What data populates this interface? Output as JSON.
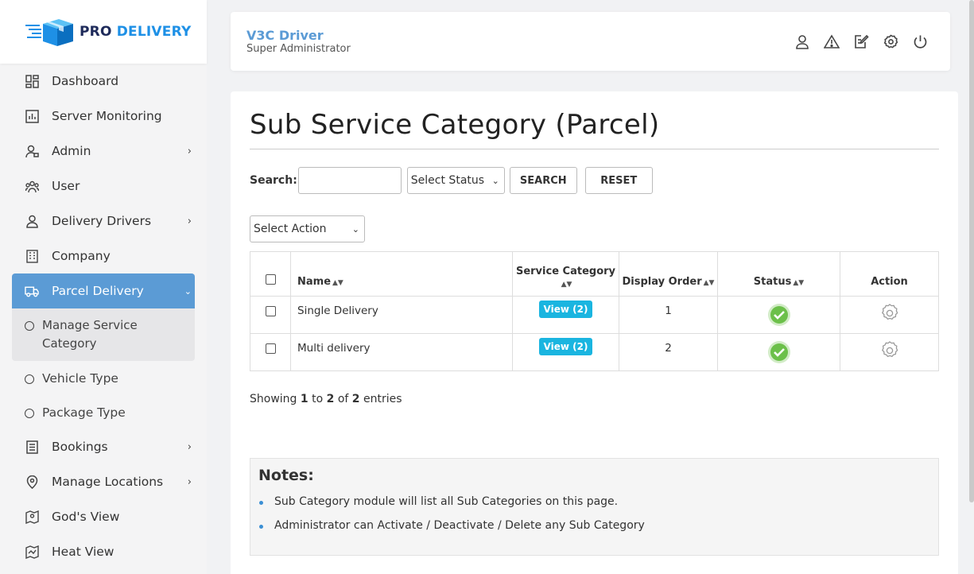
{
  "brand": {
    "pro": "PRO",
    "delivery": "DELIVERY",
    "colors": {
      "navy": "#1e2a5a",
      "blue": "#1e90e6"
    }
  },
  "sidebar": {
    "items": [
      {
        "label": "Dashboard",
        "icon": "dashboard-icon",
        "chevron": false
      },
      {
        "label": "Server Monitoring",
        "icon": "chart-icon",
        "chevron": false
      },
      {
        "label": "Admin",
        "icon": "admin-icon",
        "chevron": true
      },
      {
        "label": "User",
        "icon": "users-icon",
        "chevron": false
      },
      {
        "label": "Delivery Drivers",
        "icon": "driver-icon",
        "chevron": true
      },
      {
        "label": "Company",
        "icon": "building-icon",
        "chevron": false
      },
      {
        "label": "Parcel Delivery",
        "icon": "truck-icon",
        "chevron": true,
        "active": true
      }
    ],
    "parcel_sub_active": "Manage Service Category",
    "parcel_sub": [
      "Vehicle Type",
      "Package Type"
    ],
    "items_after": [
      {
        "label": "Bookings",
        "icon": "bookings-icon",
        "chevron": true
      },
      {
        "label": "Manage Locations",
        "icon": "location-icon",
        "chevron": true
      },
      {
        "label": "God's View",
        "icon": "map-icon",
        "chevron": false
      },
      {
        "label": "Heat View",
        "icon": "heatmap-icon",
        "chevron": false
      }
    ],
    "active_color": "#5b9bd5"
  },
  "header": {
    "name": "V3C Driver",
    "role": "Super Administrator"
  },
  "page": {
    "title": "Sub Service Category (Parcel)",
    "search_label": "Search:",
    "search_value": "",
    "status_select": "Select Status",
    "search_button": "SEARCH",
    "reset_button": "RESET",
    "action_select": "Select Action"
  },
  "table": {
    "headers": {
      "name": "Name",
      "service_category": "Service Category",
      "display_order": "Display Order",
      "status": "Status",
      "action": "Action"
    },
    "rows": [
      {
        "name": "Single Delivery",
        "service_category": "View (2)",
        "display_order": "1",
        "status": "active"
      },
      {
        "name": "Multi delivery",
        "service_category": "View (2)",
        "display_order": "2",
        "status": "active"
      }
    ]
  },
  "showing": {
    "prefix": "Showing",
    "from": "1",
    "to_word": "to",
    "to": "2",
    "of_word": "of",
    "total": "2",
    "suffix": "entries"
  },
  "notes": {
    "title": "Notes:",
    "items": [
      "Sub Category module will list all Sub Categories on this page.",
      "Administrator can Activate / Deactivate / Delete any Sub Category"
    ]
  }
}
